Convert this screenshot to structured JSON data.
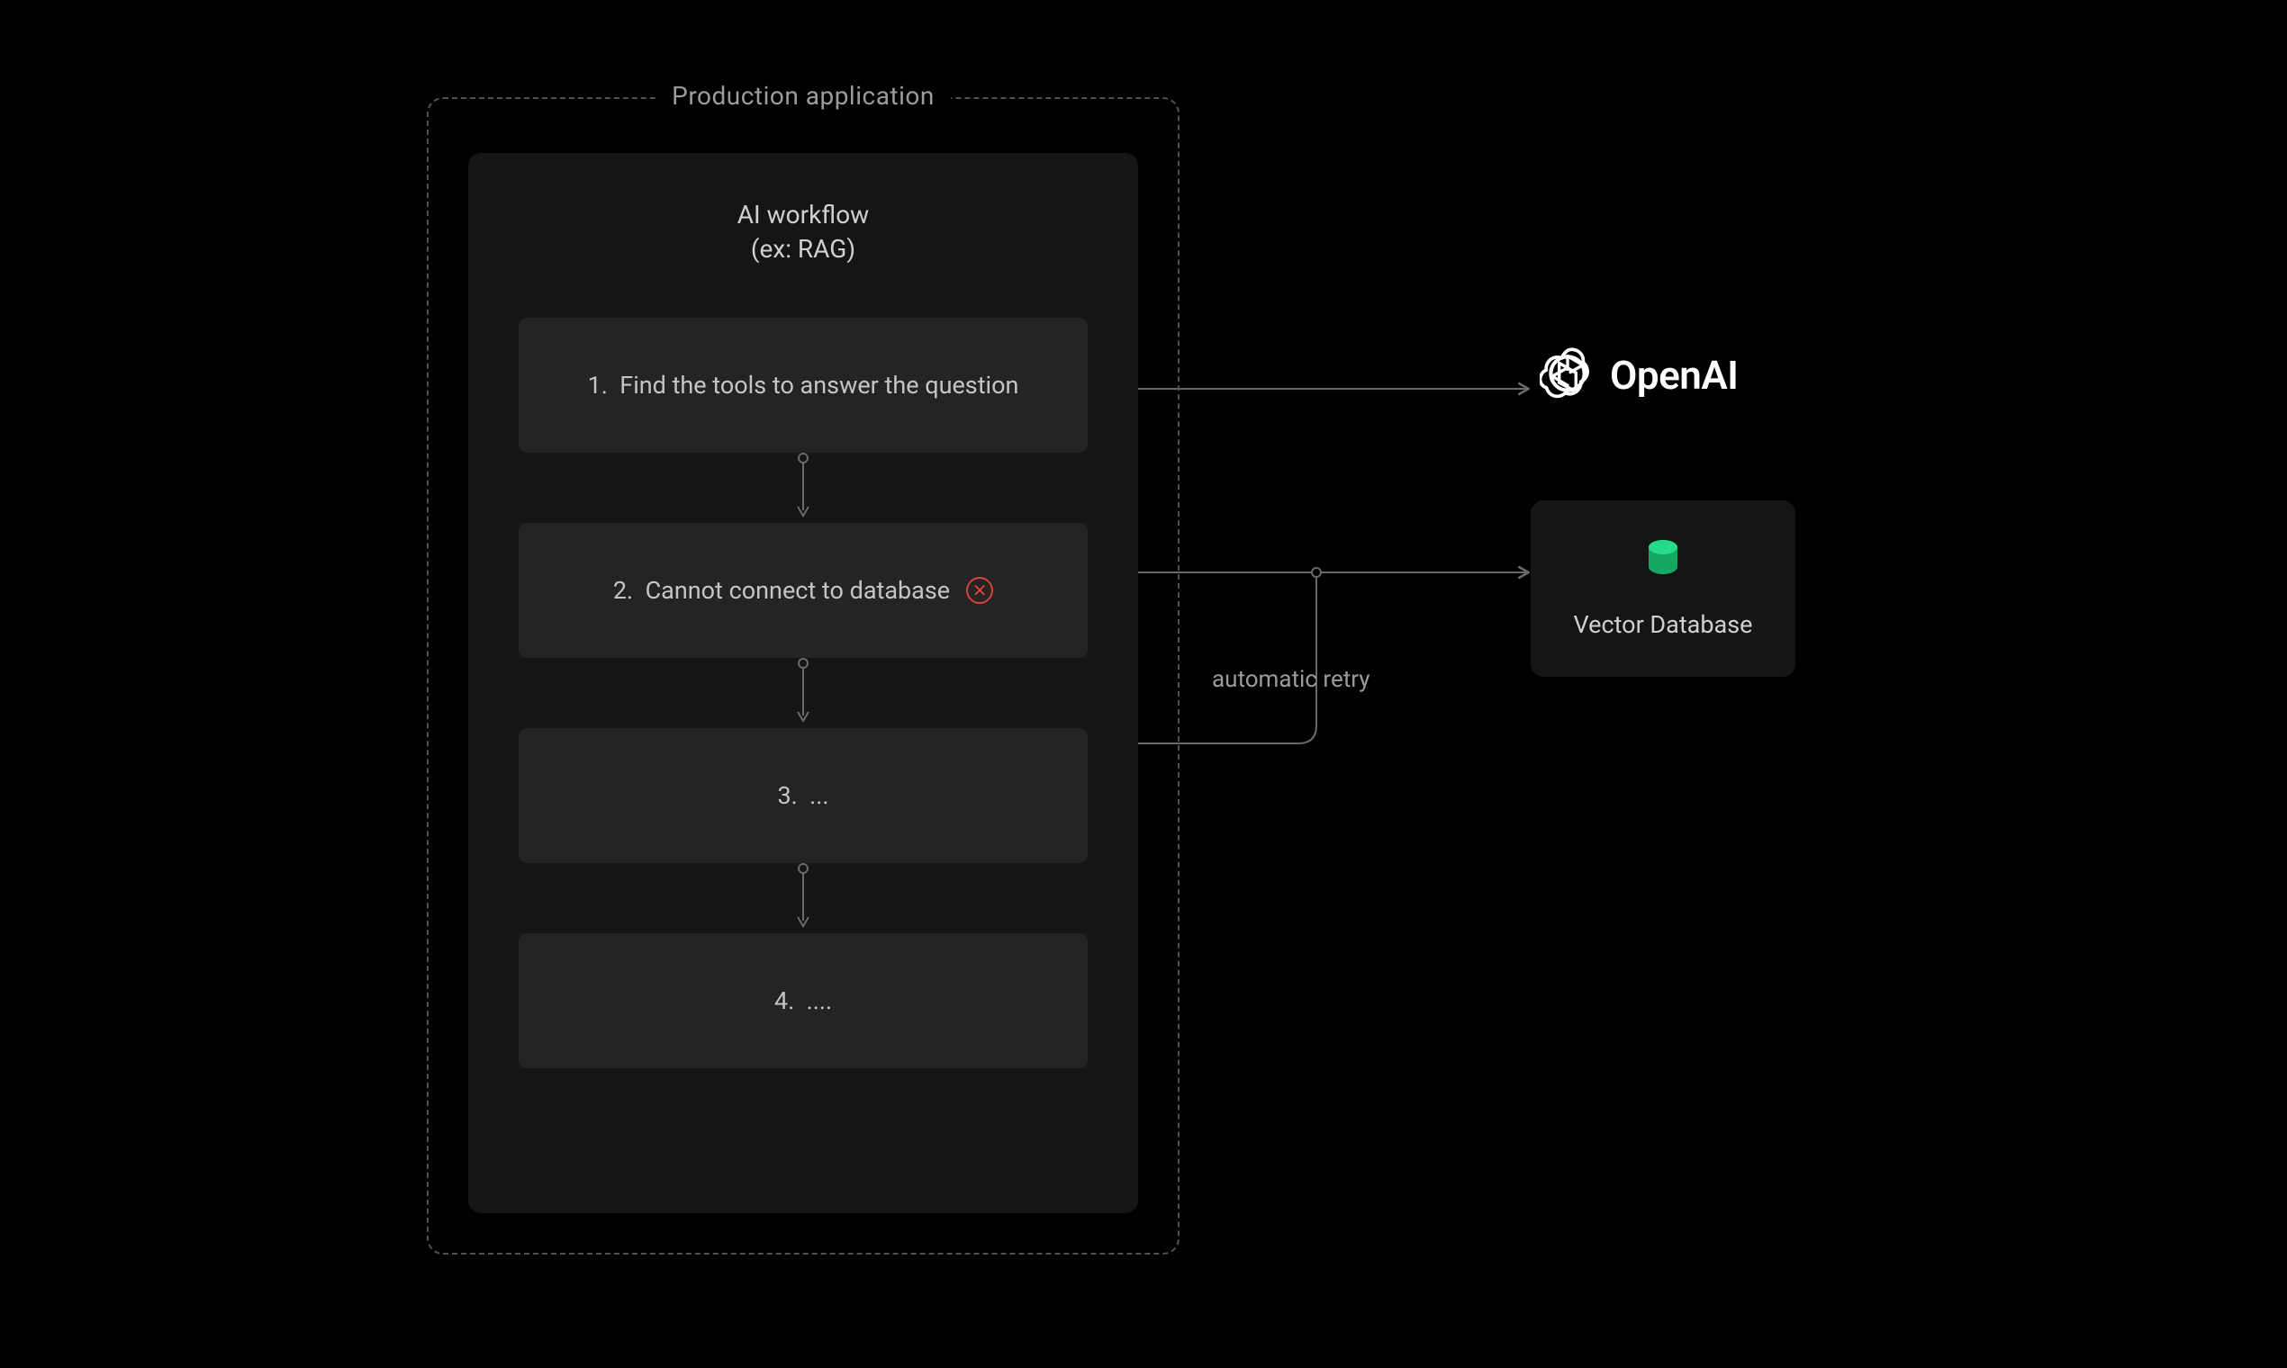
{
  "container": {
    "label": "Production application"
  },
  "workflow": {
    "title": "AI workflow",
    "subtitle": "(ex: RAG)",
    "steps": [
      {
        "num": "1.",
        "text": "Find the tools to answer the question",
        "error": false
      },
      {
        "num": "2.",
        "text": "Cannot connect to database",
        "error": true
      },
      {
        "num": "3.",
        "text": "...",
        "error": false
      },
      {
        "num": "4.",
        "text": "....",
        "error": false
      }
    ]
  },
  "endpoints": {
    "openai": "OpenAI",
    "vector_db": "Vector Database"
  },
  "labels": {
    "retry": "automatic retry"
  },
  "icons": {
    "error_glyph": "✕"
  }
}
